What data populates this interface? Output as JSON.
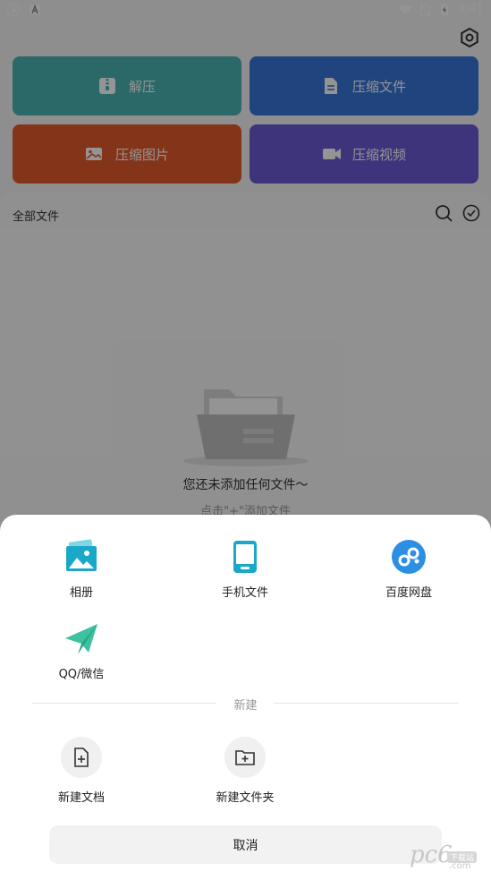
{
  "status_bar": {
    "time": "4:41"
  },
  "tiles": [
    {
      "label": "解压",
      "icon": "zip-icon",
      "color": "#4bb4b3"
    },
    {
      "label": "压缩文件",
      "icon": "document-icon",
      "color": "#3876d9"
    },
    {
      "label": "压缩图片",
      "icon": "image-icon",
      "color": "#e45a2c"
    },
    {
      "label": "压缩视频",
      "icon": "video-camera-icon",
      "color": "#6a5bd6"
    }
  ],
  "files": {
    "title": "全部文件",
    "empty_title": "您还未添加任何文件～",
    "empty_hint": "点击\"+\"添加文件"
  },
  "sheet": {
    "sources": [
      {
        "label": "相册",
        "icon": "photo-album-icon"
      },
      {
        "label": "手机文件",
        "icon": "phone-icon"
      },
      {
        "label": "百度网盘",
        "icon": "baidu-cloud-icon"
      },
      {
        "label": "QQ/微信",
        "icon": "paper-plane-icon"
      }
    ],
    "divider_label": "新建",
    "create": [
      {
        "label": "新建文档",
        "icon": "new-document-icon"
      },
      {
        "label": "新建文件夹",
        "icon": "new-folder-icon"
      }
    ],
    "cancel_label": "取消"
  },
  "watermark": {
    "text": "pc6",
    "tag": "下载站",
    "domain": ".com"
  },
  "colors": {
    "accent": "#1ba8c8",
    "overlay": "rgba(0,0,0,0.42)"
  }
}
